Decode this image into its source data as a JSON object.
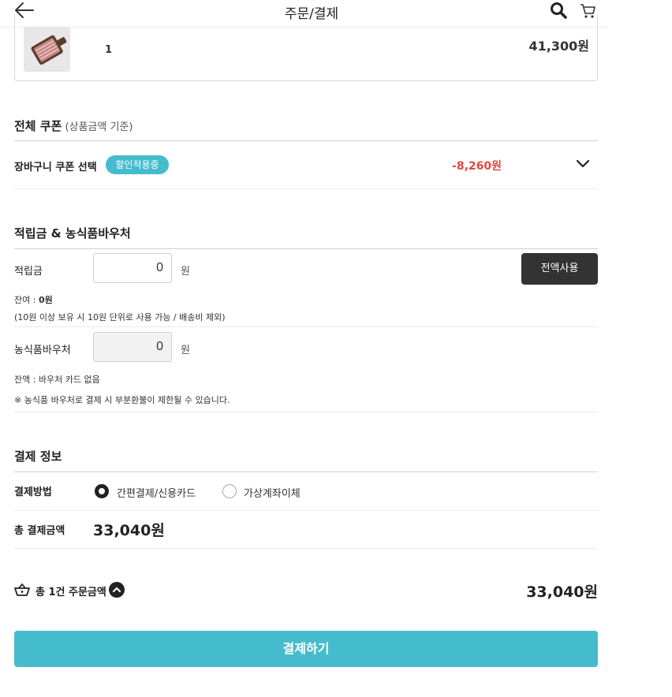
{
  "header": {
    "title": "주문/결제"
  },
  "product": {
    "quantity": "1",
    "price": "41,300원"
  },
  "coupon": {
    "title": "전체 쿠폰",
    "subtitle": "(상품금액 기준)",
    "label": "장바구니 쿠폰 선택",
    "badge": "할인적용중",
    "amount": "-8,260원"
  },
  "points": {
    "title": "적립금 & 농식품바우처",
    "label": "적립금",
    "value": "0",
    "unit": "원",
    "use_all": "전액사용",
    "balance_prefix": "잔여 : ",
    "balance_value": "0원",
    "note": "(10원 이상 보유 시 10원 단위로 사용 가능 / 배송비 제외)"
  },
  "voucher": {
    "label": "농식품바우처",
    "value": "0",
    "unit": "원",
    "balance": "잔액 : 바우처 카드 없음",
    "note": "※ 농식품 바우처로 결제 시 부분환불이 제한될 수 있습니다."
  },
  "payment": {
    "title": "결제 정보",
    "method_label": "결제방법",
    "options": [
      "간편결제/신용카드",
      "가상계좌이체"
    ],
    "selected": "간편결제/신용카드",
    "total_label": "총 결제금액",
    "total_value": "33,040원"
  },
  "summary": {
    "label": "총 1건 주문금액",
    "value": "33,040원"
  },
  "pay_button": "결제하기",
  "colors": {
    "accent": "#45bccd",
    "discount": "#e24a3b",
    "dark_button": "#333333"
  }
}
